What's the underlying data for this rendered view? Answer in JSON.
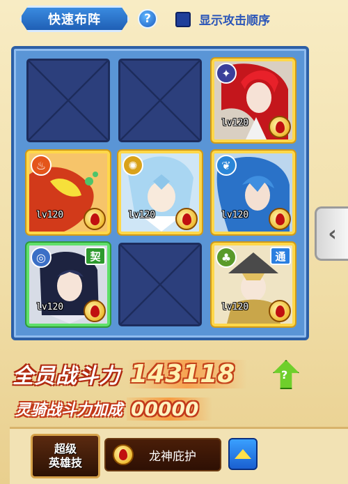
{
  "header": {
    "formation_label": "快速布阵",
    "help_label": "?",
    "show_attack_order_label": "显示攻击顺序",
    "show_attack_order_checked": true
  },
  "grid": {
    "slots": [
      {
        "row": 1,
        "col": 1,
        "empty": true
      },
      {
        "row": 1,
        "col": 2,
        "empty": true
      },
      {
        "row": 1,
        "col": 3,
        "empty": false,
        "level": "lv120",
        "element": "star-icon",
        "tag": ""
      },
      {
        "row": 2,
        "col": 1,
        "empty": false,
        "level": "lv120",
        "element": "fire-icon",
        "tag": ""
      },
      {
        "row": 2,
        "col": 2,
        "empty": false,
        "level": "lv120",
        "element": "sun-icon",
        "tag": ""
      },
      {
        "row": 2,
        "col": 3,
        "empty": false,
        "level": "lv120",
        "element": "wind-icon",
        "tag": ""
      },
      {
        "row": 3,
        "col": 1,
        "empty": false,
        "level": "lv120",
        "element": "target-icon",
        "tag": "契"
      },
      {
        "row": 3,
        "col": 2,
        "empty": true
      },
      {
        "row": 3,
        "col": 3,
        "empty": false,
        "level": "lv120",
        "element": "tree-icon",
        "tag": "通"
      }
    ]
  },
  "power": {
    "total_label": "全员战斗力",
    "total_value": "143118",
    "mount_label": "灵骑战斗力加成",
    "mount_value": "00000"
  },
  "skill": {
    "badge_line1": "超级",
    "badge_line2": "英雄技",
    "name": "龙神庇护"
  },
  "colors": {
    "panel_blue": "#5a95d6",
    "slot_border_gold": "#ffd84a",
    "slot_border_green": "#5fe06a",
    "power_red": "#b02a10"
  }
}
